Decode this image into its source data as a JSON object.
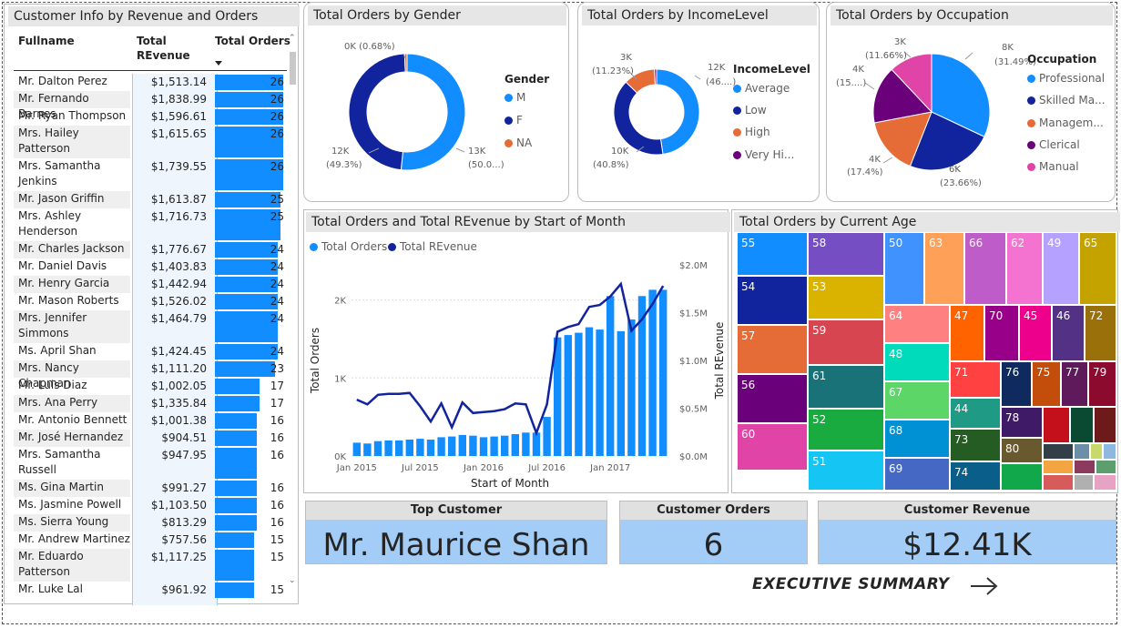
{
  "table": {
    "title": "Customer Info by Revenue and Orders",
    "columns": [
      "Fullname",
      "Total REvenue",
      "Total Orders"
    ],
    "sort_icon": "sort-descending-icon",
    "rows": [
      {
        "name": "Mr. Dalton Perez",
        "revenue": "$1,513.14",
        "orders": 26
      },
      {
        "name": "Mr. Fernando Barnes",
        "revenue": "$1,838.99",
        "orders": 26
      },
      {
        "name": "Mr. Ryan Thompson",
        "revenue": "$1,596.61",
        "orders": 26
      },
      {
        "name": "Mrs. Hailey Patterson",
        "revenue": "$1,615.65",
        "orders": 26
      },
      {
        "name": "Mrs. Samantha Jenkins",
        "revenue": "$1,739.55",
        "orders": 26
      },
      {
        "name": "Mr. Jason Griffin",
        "revenue": "$1,613.87",
        "orders": 25
      },
      {
        "name": "Mrs. Ashley Henderson",
        "revenue": "$1,716.73",
        "orders": 25
      },
      {
        "name": "Mr. Charles Jackson",
        "revenue": "$1,776.67",
        "orders": 24
      },
      {
        "name": "Mr. Daniel Davis",
        "revenue": "$1,403.83",
        "orders": 24
      },
      {
        "name": "Mr. Henry Garcia",
        "revenue": "$1,442.94",
        "orders": 24
      },
      {
        "name": "Mr. Mason Roberts",
        "revenue": "$1,526.02",
        "orders": 24
      },
      {
        "name": "Mrs. Jennifer Simmons",
        "revenue": "$1,464.79",
        "orders": 24
      },
      {
        "name": "Ms. April Shan",
        "revenue": "$1,424.45",
        "orders": 24
      },
      {
        "name": "Mrs. Nancy Chapman",
        "revenue": "$1,111.20",
        "orders": 23
      },
      {
        "name": "Mr. Luis Diaz",
        "revenue": "$1,002.05",
        "orders": 17
      },
      {
        "name": "Mrs. Ana Perry",
        "revenue": "$1,335.84",
        "orders": 17
      },
      {
        "name": "Mr. Antonio Bennett",
        "revenue": "$1,001.38",
        "orders": 16
      },
      {
        "name": "Mr. José Hernandez",
        "revenue": "$904.51",
        "orders": 16
      },
      {
        "name": "Mrs. Samantha Russell",
        "revenue": "$947.95",
        "orders": 16
      },
      {
        "name": "Ms. Gina Martin",
        "revenue": "$991.27",
        "orders": 16
      },
      {
        "name": "Ms. Jasmine Powell",
        "revenue": "$1,103.50",
        "orders": 16
      },
      {
        "name": "Ms. Sierra Young",
        "revenue": "$813.29",
        "orders": 16
      },
      {
        "name": "Mr. Andrew Martinez",
        "revenue": "$757.56",
        "orders": 15
      },
      {
        "name": "Mr. Eduardo Patterson",
        "revenue": "$1,117.25",
        "orders": 15
      },
      {
        "name": "Mr. Luke Lal",
        "revenue": "$961.92",
        "orders": 15
      }
    ]
  },
  "gender": {
    "title": "Total Orders by Gender",
    "legend_title": "Gender",
    "legend": [
      {
        "label": "M",
        "color": "#118dff"
      },
      {
        "label": "F",
        "color": "#12239e"
      },
      {
        "label": "NA",
        "color": "#e66c37"
      }
    ],
    "labels": {
      "na": "0K (0.68%)",
      "f_val": "12K",
      "f_pct": "(49.3%)",
      "m_val": "13K",
      "m_pct": "(50.0...)"
    }
  },
  "income": {
    "title": "Total Orders by IncomeLevel",
    "legend_title": "IncomeLevel",
    "legend": [
      {
        "label": "Average",
        "color": "#118dff"
      },
      {
        "label": "Low",
        "color": "#12239e"
      },
      {
        "label": "High",
        "color": "#e66c37"
      },
      {
        "label": "Very Hi...",
        "color": "#6b007b"
      }
    ],
    "labels": {
      "high_val": "3K",
      "high_pct": "(11.23%)",
      "avg_val": "12K",
      "avg_pct": "(46....)",
      "low_val": "10K",
      "low_pct": "(40.8%)"
    }
  },
  "occupation": {
    "title": "Total Orders by Occupation",
    "legend_title": "Occupation",
    "legend": [
      {
        "label": "Professional",
        "color": "#118dff"
      },
      {
        "label": "Skilled Ma...",
        "color": "#12239e"
      },
      {
        "label": "Managem...",
        "color": "#e66c37"
      },
      {
        "label": "Clerical",
        "color": "#6b007b"
      },
      {
        "label": "Manual",
        "color": "#e044a7"
      }
    ],
    "labels": {
      "manual_val": "3K",
      "manual_pct": "(11.66%)",
      "prof_val": "8K",
      "prof_pct": "(31.49%)",
      "cler_val": "4K",
      "cler_pct": "(15....)",
      "mgmt_val": "4K",
      "mgmt_pct": "(17.4%)",
      "skilled_val": "6K",
      "skilled_pct": "(23.66%)"
    }
  },
  "combo": {
    "title": "Total Orders and Total REvenue by Start of Month",
    "legend": [
      {
        "label": "Total Orders",
        "color": "#118dff"
      },
      {
        "label": "Total REvenue",
        "color": "#12239e"
      }
    ]
  },
  "treemap": {
    "title": "Total Orders by Current Age"
  },
  "cards": {
    "top_customer": {
      "label": "Top Customer",
      "value": "Mr. Maurice Shan"
    },
    "customer_orders": {
      "label": "Customer Orders",
      "value": "6"
    },
    "customer_revenue": {
      "label": "Customer Revenue",
      "value": "$12.41K"
    }
  },
  "nav": {
    "label": "EXECUTIVE SUMMARY",
    "icon": "arrow-right-icon"
  },
  "chart_data": [
    {
      "type": "pie",
      "title": "Total Orders by Gender",
      "categories": [
        "M",
        "F",
        "NA"
      ],
      "values": [
        13000,
        12000,
        170
      ],
      "percent": [
        50.0,
        49.3,
        0.68
      ],
      "donut": true
    },
    {
      "type": "pie",
      "title": "Total Orders by IncomeLevel",
      "categories": [
        "Average",
        "Low",
        "High",
        "Very High"
      ],
      "values": [
        12000,
        10000,
        3000,
        200
      ],
      "percent": [
        46.9,
        40.8,
        11.23,
        1.07
      ],
      "donut": true
    },
    {
      "type": "pie",
      "title": "Total Orders by Occupation",
      "categories": [
        "Professional",
        "Skilled Manual",
        "Management",
        "Clerical",
        "Manual"
      ],
      "values": [
        8000,
        6000,
        4000,
        4000,
        3000
      ],
      "percent": [
        31.49,
        23.66,
        17.4,
        15.79,
        11.66
      ]
    },
    {
      "type": "bar",
      "title": "Total Orders and Total REvenue by Start of Month",
      "xlabel": "Start of Month",
      "ylabel": "Total Orders",
      "y2label": "Total REvenue",
      "x_ticks": [
        "Jan 2015",
        "Jul 2015",
        "Jan 2016",
        "Jul 2016",
        "Jan 2017"
      ],
      "y_ticks": [
        "0K",
        "1K",
        "2K"
      ],
      "y2_ticks": [
        "$0.0M",
        "$0.5M",
        "$1.0M",
        "$1.5M",
        "$2.0M"
      ],
      "ylim": [
        0,
        2450
      ],
      "y2lim": [
        0,
        2000000
      ],
      "x": [
        "Jan 2015",
        "Feb 2015",
        "Mar 2015",
        "Apr 2015",
        "May 2015",
        "Jun 2015",
        "Jul 2015",
        "Aug 2015",
        "Sep 2015",
        "Oct 2015",
        "Nov 2015",
        "Dec 2015",
        "Jan 2016",
        "Feb 2016",
        "Mar 2016",
        "Apr 2016",
        "May 2016",
        "Jun 2016",
        "Jul 2016",
        "Aug 2016",
        "Sep 2016",
        "Oct 2016",
        "Nov 2016",
        "Dec 2016",
        "Jan 2017",
        "Feb 2017",
        "Mar 2017",
        "Apr 2017",
        "May 2017",
        "Jun 2017"
      ],
      "series": [
        {
          "name": "Total Orders",
          "kind": "bar",
          "values": [
            170,
            160,
            190,
            200,
            200,
            210,
            220,
            210,
            240,
            250,
            270,
            260,
            240,
            250,
            260,
            280,
            300,
            300,
            500,
            1520,
            1550,
            1580,
            1650,
            1620,
            2050,
            1600,
            1750,
            2050,
            2130,
            2130
          ]
        },
        {
          "name": "Total REvenue",
          "kind": "line",
          "values": [
            590000,
            540000,
            640000,
            650000,
            650000,
            660000,
            520000,
            360000,
            550000,
            300000,
            560000,
            450000,
            460000,
            470000,
            490000,
            550000,
            540000,
            240000,
            540000,
            1300000,
            1350000,
            1380000,
            1560000,
            1580000,
            1670000,
            1800000,
            1310000,
            1430000,
            1590000,
            1780000
          ]
        }
      ]
    },
    {
      "type": "heatmap",
      "title": "Total Orders by Current Age",
      "categories": [
        "55",
        "54",
        "57",
        "56",
        "60",
        "58",
        "53",
        "59",
        "61",
        "52",
        "51",
        "50",
        "63",
        "66",
        "62",
        "49",
        "65",
        "64",
        "48",
        "67",
        "68",
        "69",
        "47",
        "70",
        "45",
        "46",
        "72",
        "71",
        "44",
        "73",
        "74",
        "76",
        "75",
        "77",
        "79",
        "78",
        "80"
      ]
    }
  ]
}
